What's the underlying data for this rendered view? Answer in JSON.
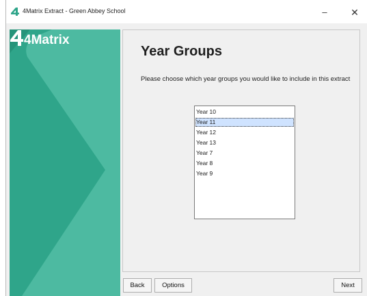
{
  "window": {
    "title": "4Matrix Extract - Green Abbey School",
    "minimize_glyph": "–",
    "close_glyph": "✕"
  },
  "brand": {
    "logo_text": "4Matrix",
    "panel_color": "#2fa58a",
    "accent_light": "#58c1a8"
  },
  "page": {
    "heading": "Year Groups",
    "description": "Please choose which year groups you would like to include in this extract"
  },
  "year_list": {
    "items": [
      "Year 10",
      "Year 11",
      "Year 12",
      "Year 13",
      "Year  7",
      "Year  8",
      "Year  9"
    ],
    "selected": "Year 11"
  },
  "buttons": {
    "back": "Back",
    "options": "Options",
    "next": "Next"
  }
}
